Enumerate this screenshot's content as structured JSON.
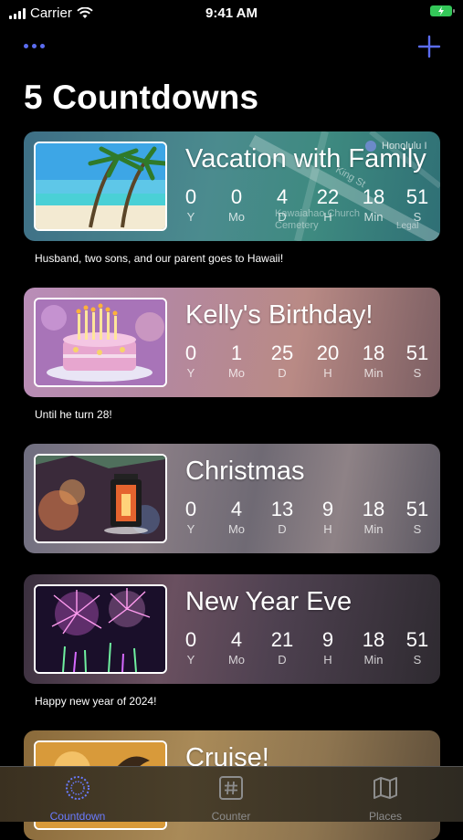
{
  "status_bar": {
    "carrier": "Carrier",
    "time": "9:41 AM"
  },
  "header": {
    "title": "5 Countdowns"
  },
  "countdowns": [
    {
      "title": "Vacation with Family",
      "values": [
        "0",
        "0",
        "4",
        "22",
        "18",
        "51"
      ],
      "labels": [
        "Y",
        "Mo",
        "D",
        "H",
        "Min",
        "S"
      ],
      "note": "Husband, two sons, and our parent goes to Hawaii!",
      "map_labels": [
        "Honolulu I",
        "Kawaiahao Church Cemetery",
        "King St",
        "Legal"
      ]
    },
    {
      "title": "Kelly's Birthday!",
      "values": [
        "0",
        "1",
        "25",
        "20",
        "18",
        "51"
      ],
      "labels": [
        "Y",
        "Mo",
        "D",
        "H",
        "Min",
        "S"
      ],
      "note": "Until he turn 28!"
    },
    {
      "title": "Christmas",
      "values": [
        "0",
        "4",
        "13",
        "9",
        "18",
        "51"
      ],
      "labels": [
        "Y",
        "Mo",
        "D",
        "H",
        "Min",
        "S"
      ],
      "note": ""
    },
    {
      "title": "New Year Eve",
      "values": [
        "0",
        "4",
        "21",
        "9",
        "18",
        "51"
      ],
      "labels": [
        "Y",
        "Mo",
        "D",
        "H",
        "Min",
        "S"
      ],
      "note": "Happy new year of 2024!"
    },
    {
      "title": "Cruise!",
      "values": [],
      "labels": [],
      "note": ""
    }
  ],
  "tabs": [
    {
      "label": "Countdown",
      "icon": "countdown-icon",
      "active": true
    },
    {
      "label": "Counter",
      "icon": "hash-icon",
      "active": false
    },
    {
      "label": "Places",
      "icon": "map-icon",
      "active": false
    }
  ],
  "colors": {
    "accent": "#5b6cf0",
    "tab_active": "#6a7bff",
    "battery": "#34c759"
  }
}
